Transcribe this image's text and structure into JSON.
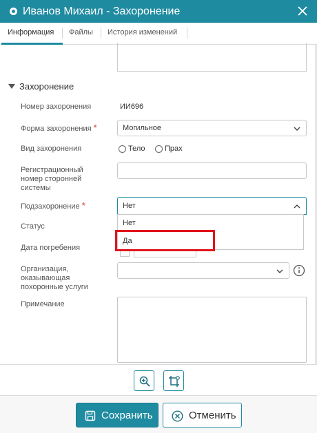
{
  "window": {
    "title": "Иванов Михаил - Захоронение",
    "accent": "#1f8ba1",
    "close_icon": "close-icon"
  },
  "tabs": [
    {
      "label": "Информация",
      "active": true
    },
    {
      "label": "Файлы",
      "active": false
    },
    {
      "label": "История изменений",
      "active": false
    }
  ],
  "section": {
    "title": "Захоронение"
  },
  "fields": {
    "burial_number": {
      "label": "Номер захоронения",
      "value": "ИИ696"
    },
    "burial_form": {
      "label": "Форма захоронения",
      "required_mark": "*",
      "value": "Могильное"
    },
    "burial_type": {
      "label": "Вид захоронения",
      "options": [
        "Тело",
        "Прах"
      ]
    },
    "reg_number": {
      "label_lines": [
        "Регистрационный",
        "номер сторонней",
        "системы"
      ],
      "value": ""
    },
    "sub_burial": {
      "label": "Подзахоронение",
      "required_mark": "*",
      "value": "Нет",
      "options": [
        "Нет",
        "Да"
      ],
      "highlighted_option": "Да"
    },
    "status": {
      "label": "Статус"
    },
    "burial_date": {
      "label": "Дата погребения"
    },
    "organization": {
      "label_lines": [
        "Организация,",
        "оказывающая",
        "похоронные услуги"
      ],
      "value": ""
    },
    "note": {
      "label": "Примечание",
      "value": ""
    }
  },
  "toolbar": {
    "zoom_icon": "zoom-in-icon",
    "crop_icon": "crop-settings-icon"
  },
  "footer": {
    "save_label": "Сохранить",
    "cancel_label": "Отменить"
  },
  "colors": {
    "required": "#d43a3a",
    "highlight": "#e0141b"
  }
}
